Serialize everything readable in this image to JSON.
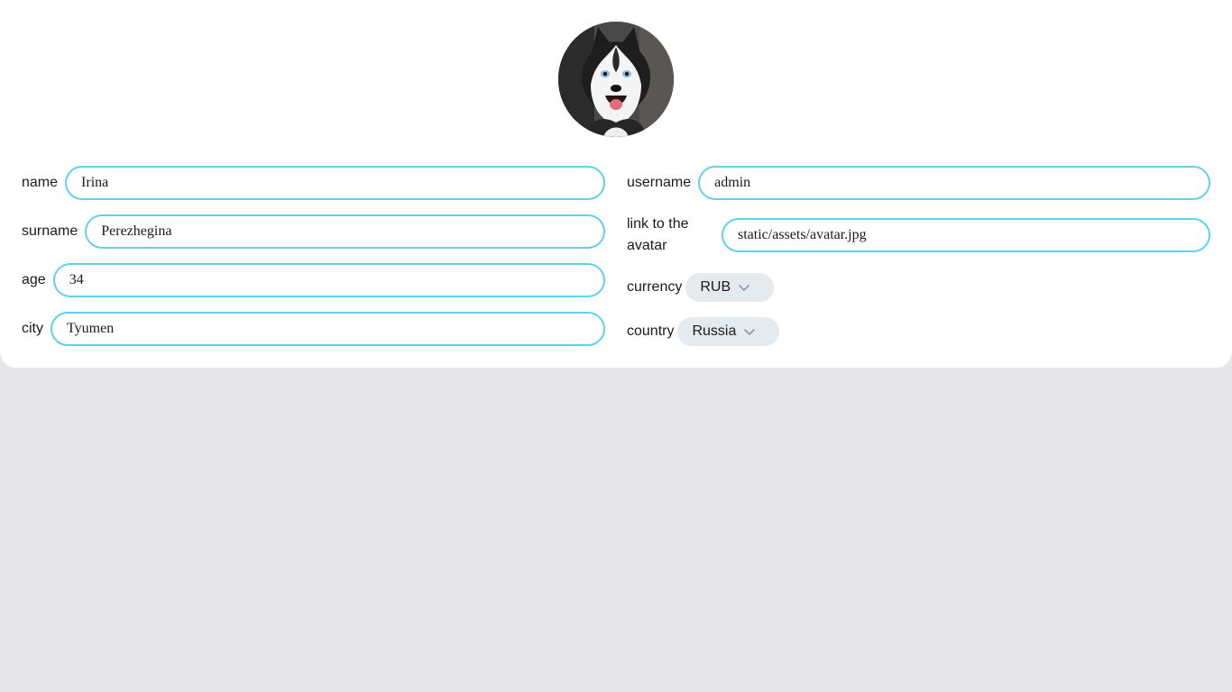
{
  "avatar": {
    "alt": "avatar",
    "icon": "husky-avatar-image"
  },
  "fields": {
    "name": {
      "label": "name",
      "value": "Irina"
    },
    "surname": {
      "label": "surname",
      "value": "Perezhegina"
    },
    "age": {
      "label": "age",
      "value": "34"
    },
    "city": {
      "label": "city",
      "value": "Tyumen"
    },
    "username": {
      "label": "username",
      "value": "admin"
    },
    "avatar_link": {
      "label": "link to the avatar",
      "value": "static/assets/avatar.jpg"
    },
    "currency": {
      "label": "currency",
      "value": "RUB"
    },
    "country": {
      "label": "country",
      "value": "Russia"
    }
  },
  "colors": {
    "accent": "#5fd1ec",
    "select_bg": "#e4eaee",
    "page_bg": "#e7e7e9"
  }
}
